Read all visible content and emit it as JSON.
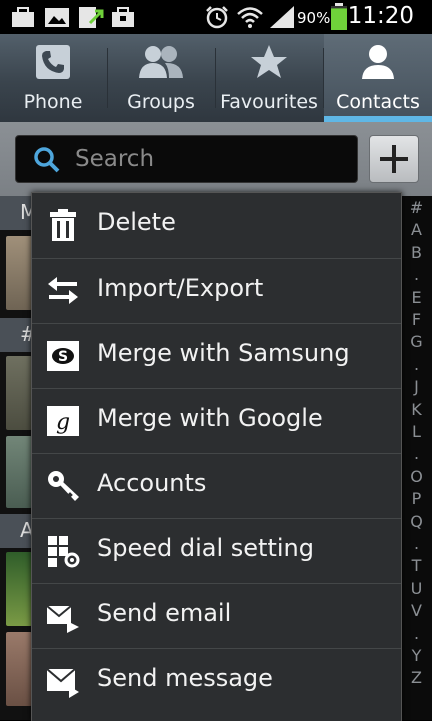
{
  "status_bar": {
    "battery_percent": "90%",
    "time": "11:20",
    "battery_level": 0.9,
    "icons": [
      "briefcase-icon",
      "gallery-icon",
      "sync-icon",
      "bag-icon",
      "alarm-icon",
      "wifi-icon",
      "signal-icon",
      "battery-icon"
    ]
  },
  "tabs": [
    {
      "label": "Phone",
      "icon": "phone-icon"
    },
    {
      "label": "Groups",
      "icon": "groups-icon"
    },
    {
      "label": "Favourites",
      "icon": "star-icon"
    },
    {
      "label": "Contacts",
      "icon": "person-icon",
      "selected": true
    }
  ],
  "search": {
    "placeholder": "Search"
  },
  "contact_list": {
    "sections": [
      "M",
      "#",
      "A"
    ]
  },
  "index": [
    "#",
    "A",
    "B",
    ".",
    "E",
    "F",
    "G",
    ".",
    "J",
    "K",
    "L",
    ".",
    "O",
    "P",
    "Q",
    ".",
    "T",
    "U",
    "V",
    ".",
    "Y",
    "Z"
  ],
  "menu": {
    "items": [
      {
        "label": "Delete",
        "icon": "trash-icon"
      },
      {
        "label": "Import/Export",
        "icon": "import-export-icon"
      },
      {
        "label": "Merge with Samsung",
        "icon": "samsung-icon"
      },
      {
        "label": "Merge with Google",
        "icon": "google-icon"
      },
      {
        "label": "Accounts",
        "icon": "key-icon"
      },
      {
        "label": "Speed dial setting",
        "icon": "speed-dial-icon"
      },
      {
        "label": "Send email",
        "icon": "email-icon"
      },
      {
        "label": "Send message",
        "icon": "message-icon"
      }
    ]
  },
  "colors": {
    "accent": "#5fb7e6",
    "battery": "#6fd13a"
  }
}
